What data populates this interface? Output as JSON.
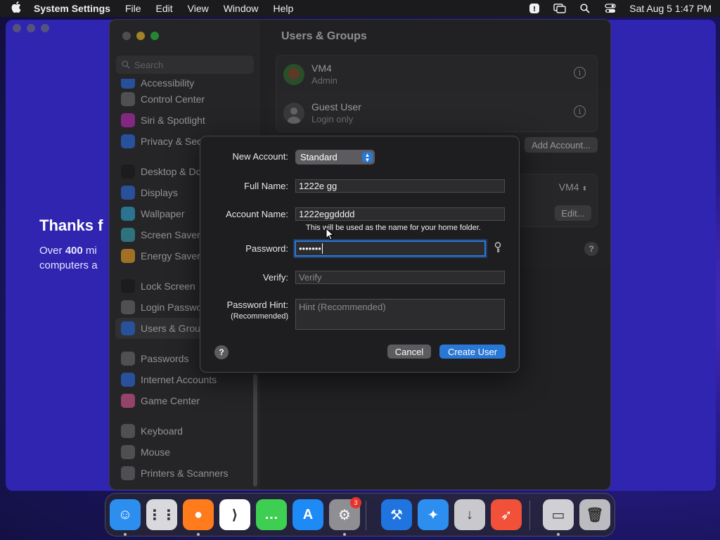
{
  "menubar": {
    "app_name": "System Settings",
    "items": [
      "File",
      "Edit",
      "View",
      "Window",
      "Help"
    ],
    "clock": "Sat Aug 5  1:47 PM"
  },
  "background_window": {
    "headline": "Thanks f",
    "subtext_prefix": "Over ",
    "subtext_number": "400",
    "subtext_line1_rest": " mi",
    "subtext_line2": "computers a"
  },
  "sidebar": {
    "search_placeholder": "Search",
    "items": [
      {
        "label": "Accessibility",
        "icon": "accessibility-icon",
        "color": "#2f6ee6"
      },
      {
        "label": "Control Center",
        "icon": "control-center-icon",
        "color": "#6e6e73"
      },
      {
        "label": "Siri & Spotlight",
        "icon": "siri-icon",
        "color": "#c02fbf"
      },
      {
        "label": "Privacy & Secu",
        "icon": "hand-icon",
        "color": "#2f6ee6"
      },
      {
        "label": "Desktop & Doc",
        "icon": "desktop-dock-icon",
        "color": "#1b1b1d"
      },
      {
        "label": "Displays",
        "icon": "displays-icon",
        "color": "#2f6ee6"
      },
      {
        "label": "Wallpaper",
        "icon": "wallpaper-icon",
        "color": "#35a7d6"
      },
      {
        "label": "Screen Saver",
        "icon": "screen-saver-icon",
        "color": "#3aa6b8"
      },
      {
        "label": "Energy Saver",
        "icon": "battery-icon",
        "color": "#f0a22a"
      },
      {
        "label": "Lock Screen",
        "icon": "lock-icon",
        "color": "#1b1b1d"
      },
      {
        "label": "Login Passwor",
        "icon": "login-password-icon",
        "color": "#6e6e73"
      },
      {
        "label": "Users & Group",
        "icon": "users-icon",
        "color": "#2f6ee6"
      },
      {
        "label": "Passwords",
        "icon": "key-icon",
        "color": "#6e6e73"
      },
      {
        "label": "Internet Accounts",
        "icon": "at-icon",
        "color": "#2f6ee6"
      },
      {
        "label": "Game Center",
        "icon": "game-center-icon",
        "color": "#e05a9a"
      },
      {
        "label": "Keyboard",
        "icon": "keyboard-icon",
        "color": "#6e6e73"
      },
      {
        "label": "Mouse",
        "icon": "mouse-icon",
        "color": "#6e6e73"
      },
      {
        "label": "Printers & Scanners",
        "icon": "printer-icon",
        "color": "#6e6e73"
      }
    ]
  },
  "content": {
    "title": "Users & Groups",
    "users": [
      {
        "name": "VM4",
        "role": "Admin"
      },
      {
        "name": "Guest User",
        "role": "Login only"
      }
    ],
    "add_account": "Add Account...",
    "auto_login_value": "VM4",
    "edit_label": "Edit..."
  },
  "dialog": {
    "new_account_label": "New Account:",
    "account_type": "Standard",
    "full_name_label": "Full Name:",
    "full_name_value": "1222e gg",
    "account_name_label": "Account Name:",
    "account_name_value": "1222eggdddd",
    "account_name_note": "This will be used as the name for your home folder.",
    "password_label": "Password:",
    "password_value": "•••••••",
    "verify_label": "Verify:",
    "verify_placeholder": "Verify",
    "hint_label": "Password Hint:",
    "hint_label_sub": "(Recommended)",
    "hint_placeholder": "Hint (Recommended)",
    "cancel": "Cancel",
    "create": "Create User"
  },
  "dock": {
    "badge_count": "3",
    "items": [
      {
        "name": "finder",
        "color": "#2c8ff0"
      },
      {
        "name": "launchpad",
        "color": "#d9d9dd"
      },
      {
        "name": "firefox",
        "color": "#ff7b1c"
      },
      {
        "name": "vscode",
        "color": "#ffffff"
      },
      {
        "name": "messages",
        "color": "#3ecf52"
      },
      {
        "name": "app-store",
        "color": "#1d8af5"
      },
      {
        "name": "system-settings",
        "color": "#8e8e93"
      },
      {
        "name": "xcode",
        "color": "#1f74e0"
      },
      {
        "name": "instruments",
        "color": "#2c8ff0"
      },
      {
        "name": "installer",
        "color": "#c9c9cd"
      },
      {
        "name": "swift",
        "color": "#f05138"
      },
      {
        "name": "disk-image",
        "color": "#d0d0d4"
      },
      {
        "name": "trash",
        "color": "#bcbcc0"
      }
    ]
  }
}
